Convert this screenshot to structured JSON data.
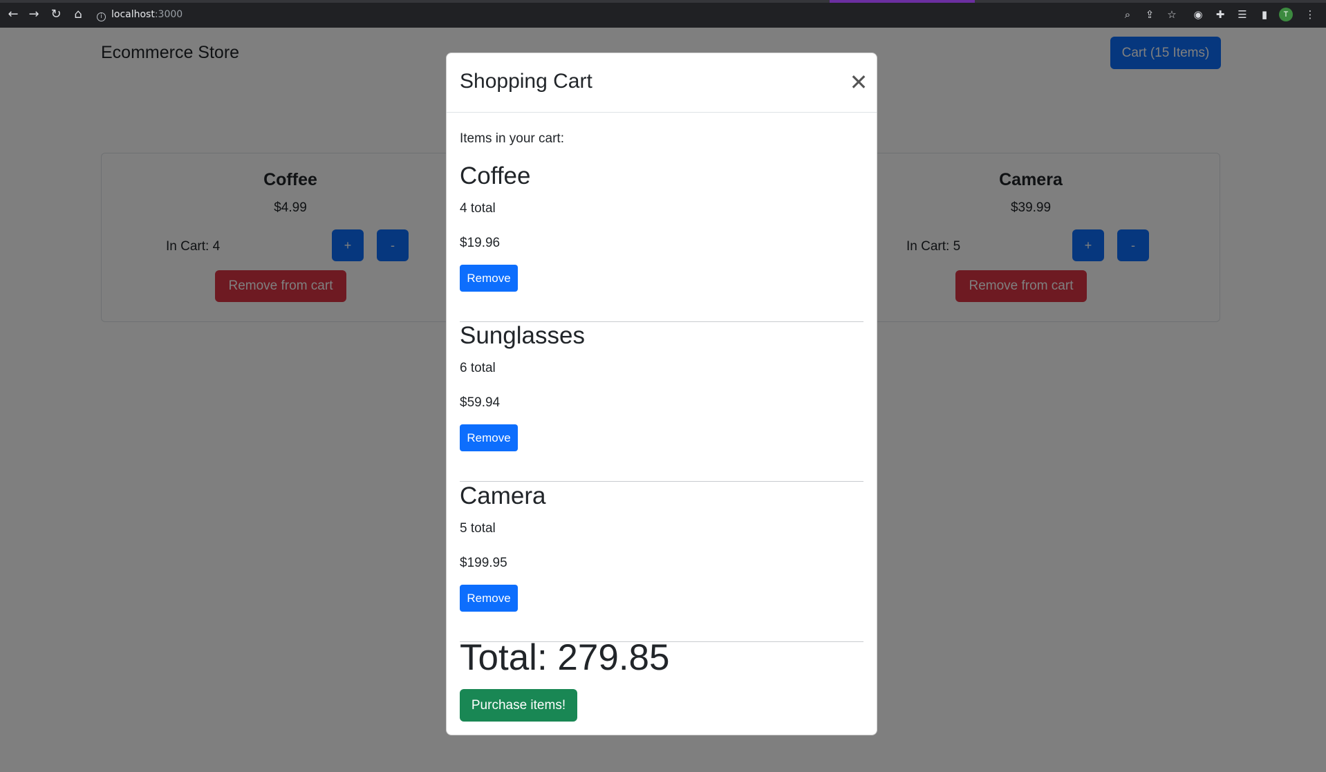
{
  "browser": {
    "url_host": "localhost",
    "url_port": ":3000",
    "profile_initial": "T"
  },
  "header": {
    "store_title": "Ecommerce Store",
    "cart_button_label": "Cart (15 Items)"
  },
  "products": [
    {
      "name": "Coffee",
      "price": "$4.99",
      "in_cart": "In Cart: 4",
      "plus": "+",
      "minus": "-",
      "remove_label": "Remove from cart"
    },
    {
      "name": "Camera",
      "price": "$39.99",
      "in_cart": "In Cart: 5",
      "plus": "+",
      "minus": "-",
      "remove_label": "Remove from cart"
    }
  ],
  "modal": {
    "title": "Shopping Cart",
    "intro": "Items in your cart:",
    "items": [
      {
        "name": "Coffee",
        "count": "4 total",
        "price": "$19.96",
        "remove_label": "Remove"
      },
      {
        "name": "Sunglasses",
        "count": "6 total",
        "price": "$59.94",
        "remove_label": "Remove"
      },
      {
        "name": "Camera",
        "count": "5 total",
        "price": "$199.95",
        "remove_label": "Remove"
      }
    ],
    "total": "Total: 279.85",
    "purchase_label": "Purchase items!"
  },
  "colors": {
    "primary": "#0d6efd",
    "danger": "#dc3545",
    "success": "#198754"
  }
}
